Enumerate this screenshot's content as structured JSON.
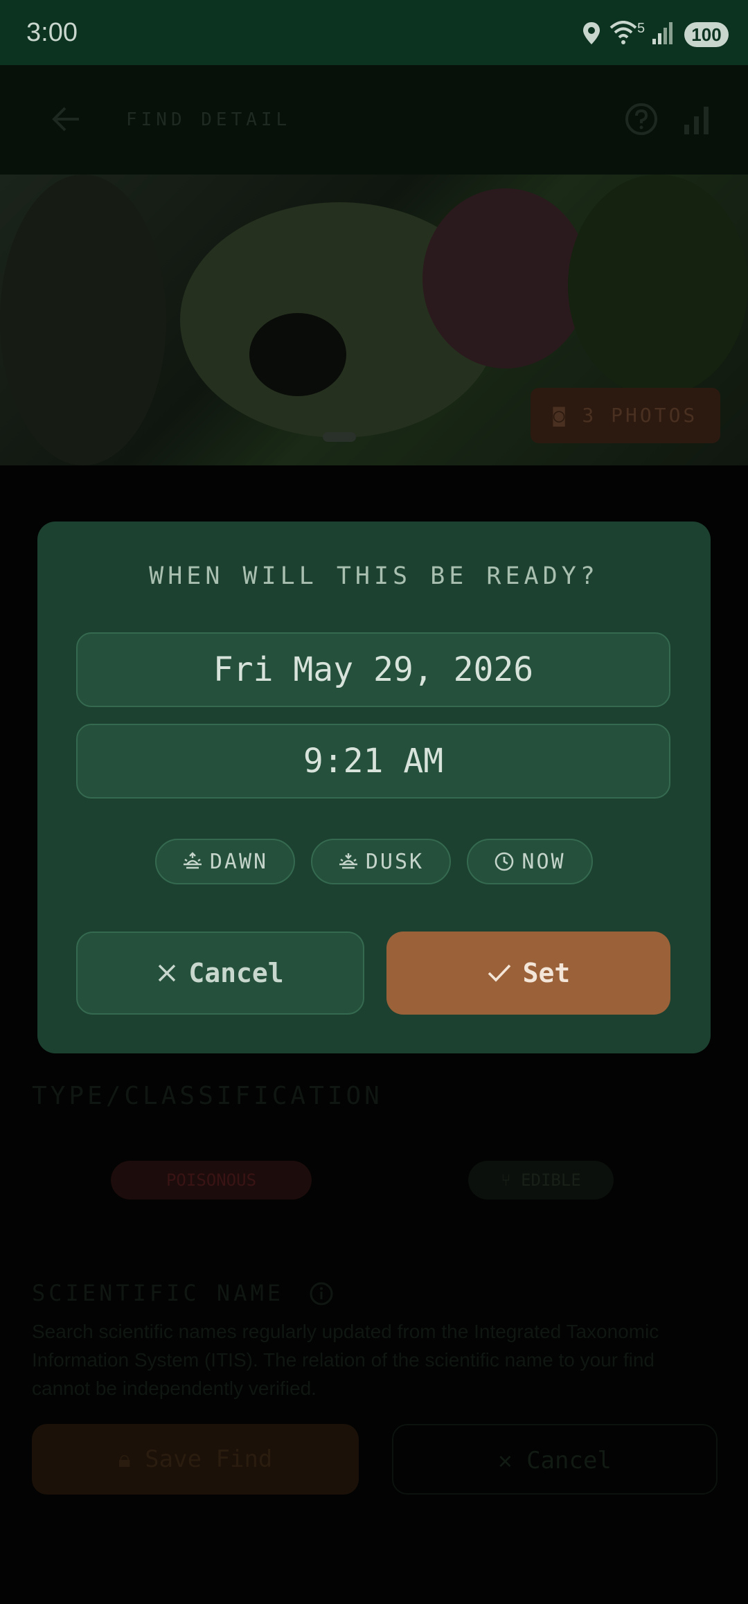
{
  "status_bar": {
    "time": "3:00",
    "battery": "100",
    "network": "5"
  },
  "background": {
    "app_title": "FIND DETAIL",
    "photos_chip": "3 PHOTOS",
    "type_heading": "TYPE/CLASSIFICATION",
    "chip_poison": "POISONOUS",
    "chip_edible": "EDIBLE",
    "scientific_heading": "SCIENTIFIC NAME",
    "scientific_desc": "Search scientific names regularly updated from the Integrated Taxonomic Information System (ITIS). The relation of the scientific name to your find cannot be independently verified.",
    "save_label": "Save Find",
    "cancel_label": "Cancel"
  },
  "dialog": {
    "title": "WHEN WILL THIS BE READY?",
    "date": "Fri May 29, 2026",
    "time": "9:21 AM",
    "chips": {
      "dawn": "DAWN",
      "dusk": "DUSK",
      "now": "NOW"
    },
    "cancel_label": "Cancel",
    "set_label": "Set"
  },
  "colors": {
    "dialog_bg": "#1c4130",
    "accent": "#9b6139",
    "status_bar": "#0c3320"
  }
}
